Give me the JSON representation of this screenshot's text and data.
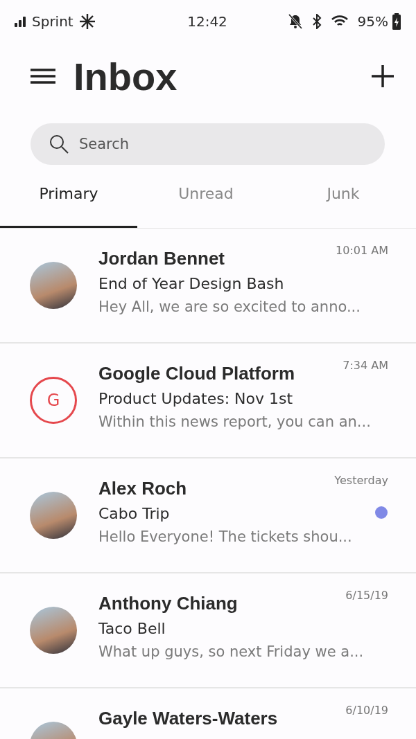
{
  "status_bar": {
    "carrier": "Sprint",
    "time": "12:42",
    "battery": "95%"
  },
  "header": {
    "title": "Inbox"
  },
  "search": {
    "placeholder": "Search"
  },
  "tabs": [
    {
      "label": "Primary",
      "selected": true
    },
    {
      "label": "Unread",
      "selected": false
    },
    {
      "label": "Junk",
      "selected": false
    }
  ],
  "messages": [
    {
      "sender": "Jordan Bennet",
      "subject": "End of Year Design Bash",
      "preview": "Hey All, we are so excited to anno...",
      "time": "10:01 AM",
      "avatar": {
        "kind": "photo"
      },
      "unread": false
    },
    {
      "sender": "Google Cloud Platform",
      "subject": "Product Updates: Nov 1st",
      "preview": "Within this news report, you can an...",
      "time": "7:34 AM",
      "avatar": {
        "kind": "letter",
        "letter": "G",
        "color": "#e5484d"
      },
      "unread": false
    },
    {
      "sender": "Alex Roch",
      "subject": "Cabo Trip",
      "preview": "Hello Everyone! The tickets shou...",
      "time": "Yesterday",
      "avatar": {
        "kind": "photo"
      },
      "unread": true,
      "color": "#8089e6"
    },
    {
      "sender": "Anthony Chiang",
      "subject": "Taco Bell",
      "preview": "What up guys, so next Friday we a...",
      "time": "6/15/19",
      "avatar": {
        "kind": "photo"
      },
      "unread": false
    },
    {
      "sender": "Gayle Waters-Waters",
      "time": "6/10/19",
      "avatar": {
        "kind": "photo"
      }
    }
  ]
}
